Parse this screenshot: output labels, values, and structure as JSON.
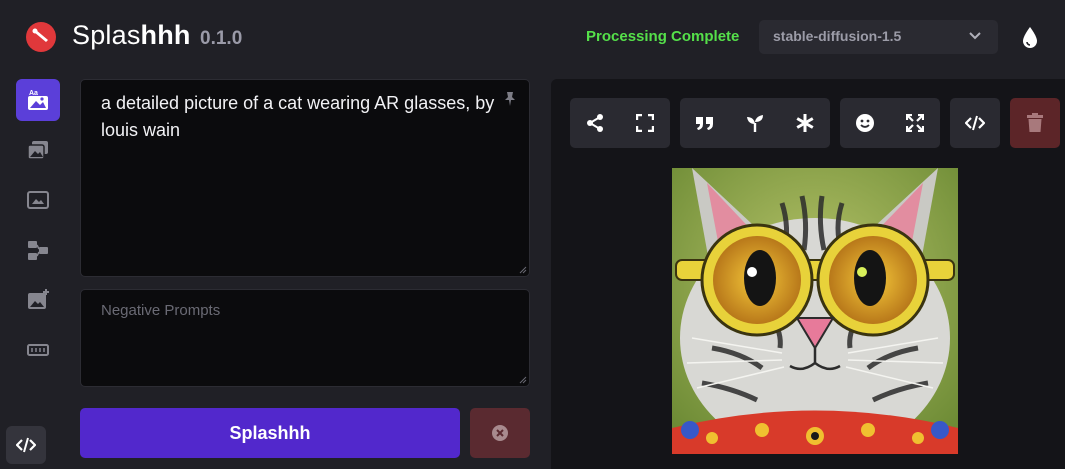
{
  "header": {
    "app_name_light": "Splas",
    "app_name_bold": "hhh",
    "version": "0.1.0",
    "status": "Processing Complete",
    "model": "stable-diffusion-1.5"
  },
  "nav": {
    "items": [
      {
        "name": "text-to-image",
        "active": true
      },
      {
        "name": "image-to-image",
        "active": false
      },
      {
        "name": "inpainting",
        "active": false
      },
      {
        "name": "controlnet",
        "active": false
      },
      {
        "name": "upscale",
        "active": false
      },
      {
        "name": "merge-models",
        "active": false
      }
    ]
  },
  "prompt": {
    "text": "a detailed picture of a cat wearing AR glasses, by louis wain",
    "negative_placeholder": "Negative Prompts",
    "negative_value": ""
  },
  "actions": {
    "generate_label": "Splashhh"
  },
  "toolbar": {
    "groups": [
      [
        "share-icon",
        "fullscreen-icon"
      ],
      [
        "quote-icon",
        "seedling-icon",
        "asterisk-icon"
      ],
      [
        "face-restore-icon",
        "upscale-expand-icon"
      ],
      [
        "code-icon"
      ]
    ]
  },
  "colors": {
    "accent": "#5228cc",
    "status_green": "#55e04a",
    "danger": "#5c2528",
    "logo": "#e0383b"
  }
}
